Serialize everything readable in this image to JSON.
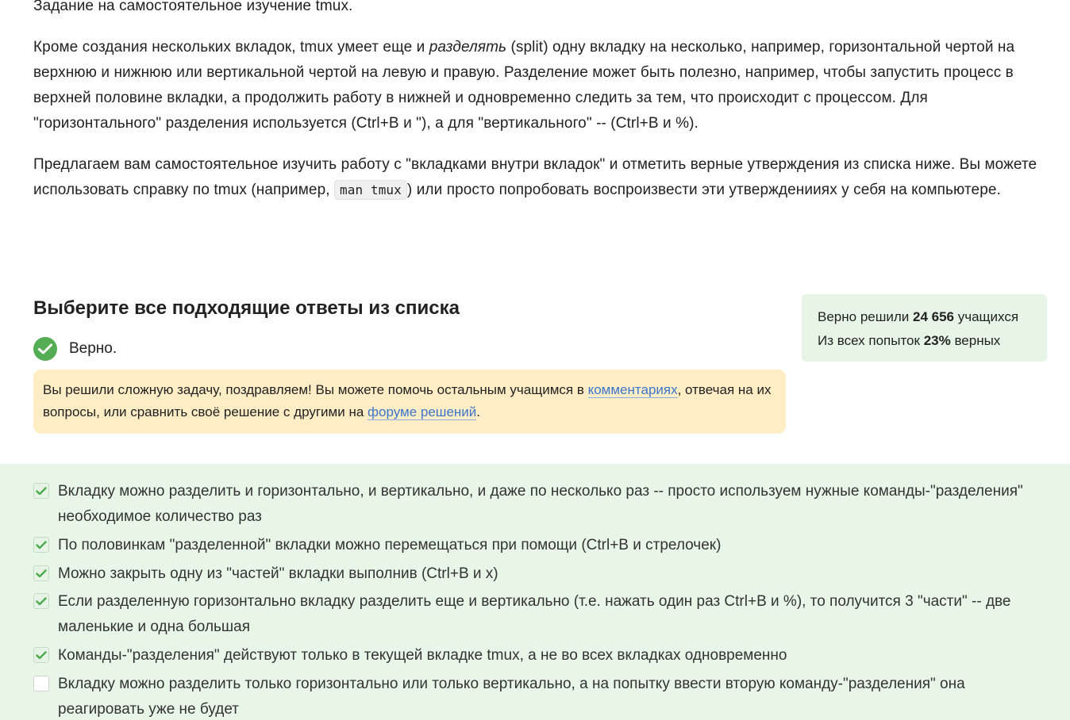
{
  "lesson": {
    "p0": "Задание на самостоятельное изучение tmux.",
    "p1": {
      "before": "Кроме создания нескольких вкладок, tmux умеет еще и ",
      "emphasis": "разделять",
      "after": " (split) одну вкладку на несколько, например, горизонтальной чертой на верхнюю и нижнюю или вертикальной чертой на левую и правую. Разделение может быть полезно, например, чтобы запустить процесс в верхней половине вкладки, а продолжить работу в нижней и одновременно следить за тем, что происходит с процессом. Для \"горизонтального\" разделения используется (Ctrl+B и \"), а для \"вертикального\" -- (Ctrl+B и %)."
    },
    "p2": {
      "before": "Предлагаем вам самостоятельное изучить работу с \"вкладками внутри вкладок\" и отметить верные утверждения из списка ниже. Вы можете использовать справку по tmux (например, ",
      "code": "man tmux",
      "after": ") или просто попробовать воспроизвести эти утвержденииях у себя на компьютере."
    }
  },
  "quiz": {
    "title": "Выберите все подходящие ответы из списка",
    "verdict": "Верно.",
    "icon": "check-circle-icon",
    "accent_color": "#54ad54"
  },
  "stats": {
    "line1_prefix": "Верно решили ",
    "solved_count": "24 656",
    "line1_suffix": " учащихся",
    "line2_prefix": "Из всех попыток ",
    "percent": "23%",
    "line2_suffix": " верных"
  },
  "congrats": {
    "text1": "Вы решили сложную задачу, поздравляем! Вы можете помочь остальным учащимся в ",
    "link1": "комментариях",
    "text2": ", отвечая на их вопросы, или сравнить своё решение с другими на ",
    "link2": "форуме решений",
    "text3": "."
  },
  "options": [
    {
      "text": "Вкладку можно разделить и горизонтально, и вертикально, и даже по несколько раз -- просто используем нужные команды-\"разделения\" необходимое количество раз",
      "checked": true
    },
    {
      "text": "По половинкам \"разделенной\" вкладки можно перемещаться при помощи (Ctrl+B и стрелочек)",
      "checked": true
    },
    {
      "text": "Можно закрыть одну из \"частей\" вкладки выполнив (Ctrl+B и x)",
      "checked": true
    },
    {
      "text": "Если разделенную горизонтально вкладку разделить еще и вертикально (т.е. нажать один раз Ctrl+B и %), то получится 3 \"части\" -- две маленькие и одна большая",
      "checked": true
    },
    {
      "text": "Команды-\"разделения\" действуют только в текущей вкладке tmux, а не во всех вкладках одновременно",
      "checked": true
    },
    {
      "text": "Вкладку можно разделить только горизонтально или только вертикально, а на попытку ввести вторую команду-\"разделения\" она реагировать уже не будет",
      "checked": false
    }
  ]
}
